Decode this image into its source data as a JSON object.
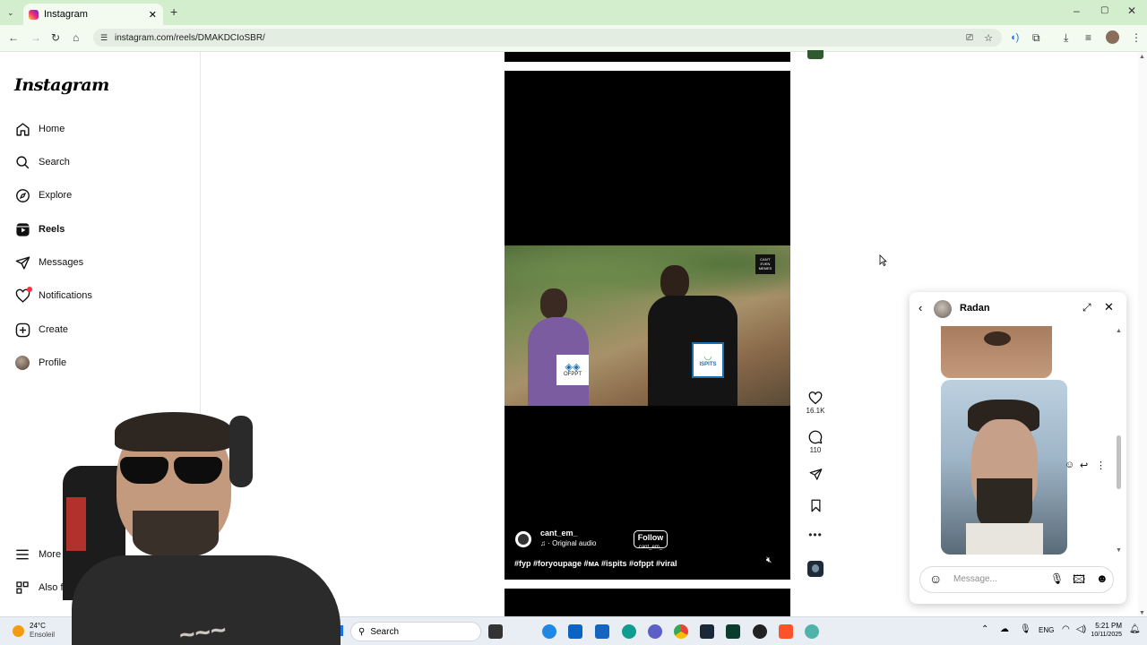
{
  "browser": {
    "tab_title": "Instagram",
    "url": "instagram.com/reels/DMAKDCIoSBR/"
  },
  "sidebar": {
    "logo": "Instagram",
    "items": [
      {
        "label": "Home",
        "icon": "home-icon"
      },
      {
        "label": "Search",
        "icon": "search-icon"
      },
      {
        "label": "Explore",
        "icon": "explore-icon"
      },
      {
        "label": "Reels",
        "icon": "reels-icon"
      },
      {
        "label": "Messages",
        "icon": "messages-icon"
      },
      {
        "label": "Notifications",
        "icon": "heart-icon"
      },
      {
        "label": "Create",
        "icon": "plus-square-icon"
      },
      {
        "label": "Profile",
        "icon": "avatar"
      }
    ],
    "more_label": "More",
    "also_label": "Also fro"
  },
  "reel": {
    "username": "cant_em_",
    "audio": "· Original audio",
    "follow_label": "Follow",
    "follow_sub": "cant_em_",
    "caption": "#fyp #foryoupage #ᴍᴀ #ispits #ofppt #viral",
    "watermark": "CAN'T EVEN MEMES",
    "logo_left": "OFPPT",
    "logo_right": "ISPITS",
    "likes": "16.1K",
    "comments": "110"
  },
  "chat": {
    "name": "Radan",
    "placeholder": "Message..."
  },
  "taskbar": {
    "weather_temp": "24°C",
    "weather_desc": "Ensoleil",
    "search_label": "Search",
    "lang": "ENG",
    "time": "5:21 PM",
    "date": "10/11/2025"
  },
  "colors": {
    "tabbar": "#d3eecd",
    "notification_dot": "#ff3040",
    "follow_border": "#ffffff"
  }
}
